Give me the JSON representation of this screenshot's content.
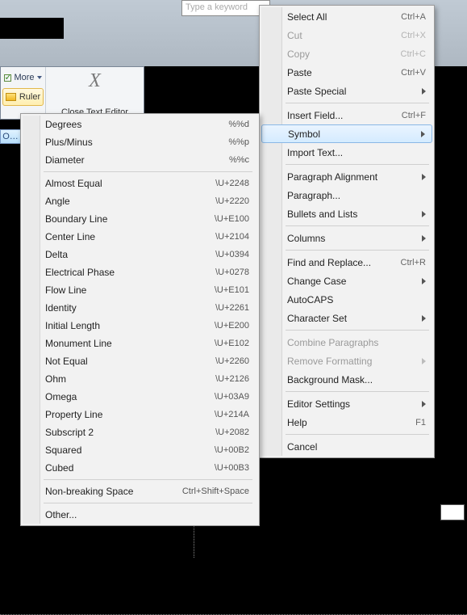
{
  "ribbon": {
    "keyword_placeholder": "Type a keyword",
    "more_label": "More",
    "ruler_label": "Ruler",
    "close_label": "Close Text Editor",
    "close_icon": "X",
    "options_tab": "O…"
  },
  "context_menu": {
    "groups": [
      [
        {
          "label": "Select All",
          "accel": "Ctrl+A",
          "enabled": true
        },
        {
          "label": "Cut",
          "accel": "Ctrl+X",
          "enabled": false
        },
        {
          "label": "Copy",
          "accel": "Ctrl+C",
          "enabled": false
        },
        {
          "label": "Paste",
          "accel": "Ctrl+V",
          "enabled": true
        },
        {
          "label": "Paste Special",
          "submenu": true,
          "enabled": true
        }
      ],
      [
        {
          "label": "Insert Field...",
          "accel": "Ctrl+F",
          "enabled": true
        },
        {
          "label": "Symbol",
          "submenu": true,
          "enabled": true,
          "highlight": true
        },
        {
          "label": "Import Text...",
          "enabled": true
        }
      ],
      [
        {
          "label": "Paragraph Alignment",
          "submenu": true,
          "enabled": true
        },
        {
          "label": "Paragraph...",
          "enabled": true
        },
        {
          "label": "Bullets and Lists",
          "submenu": true,
          "enabled": true
        }
      ],
      [
        {
          "label": "Columns",
          "submenu": true,
          "enabled": true
        }
      ],
      [
        {
          "label": "Find and Replace...",
          "accel": "Ctrl+R",
          "enabled": true
        },
        {
          "label": "Change Case",
          "submenu": true,
          "enabled": true
        },
        {
          "label": "AutoCAPS",
          "enabled": true
        },
        {
          "label": "Character Set",
          "submenu": true,
          "enabled": true
        }
      ],
      [
        {
          "label": "Combine Paragraphs",
          "enabled": false
        },
        {
          "label": "Remove Formatting",
          "submenu": true,
          "enabled": false
        },
        {
          "label": "Background Mask...",
          "enabled": true
        }
      ],
      [
        {
          "label": "Editor Settings",
          "submenu": true,
          "enabled": true
        },
        {
          "label": "Help",
          "accel": "F1",
          "enabled": true
        }
      ],
      [
        {
          "label": "Cancel",
          "enabled": true
        }
      ]
    ]
  },
  "symbol_menu": {
    "groups": [
      [
        {
          "label": "Degrees",
          "code": "%%d"
        },
        {
          "label": "Plus/Minus",
          "code": "%%p"
        },
        {
          "label": "Diameter",
          "code": "%%c"
        }
      ],
      [
        {
          "label": "Almost Equal",
          "code": "\\U+2248"
        },
        {
          "label": "Angle",
          "code": "\\U+2220"
        },
        {
          "label": "Boundary Line",
          "code": "\\U+E100"
        },
        {
          "label": "Center Line",
          "code": "\\U+2104"
        },
        {
          "label": "Delta",
          "code": "\\U+0394"
        },
        {
          "label": "Electrical Phase",
          "code": "\\U+0278"
        },
        {
          "label": "Flow Line",
          "code": "\\U+E101"
        },
        {
          "label": "Identity",
          "code": "\\U+2261"
        },
        {
          "label": "Initial Length",
          "code": "\\U+E200"
        },
        {
          "label": "Monument Line",
          "code": "\\U+E102"
        },
        {
          "label": "Not Equal",
          "code": "\\U+2260"
        },
        {
          "label": "Ohm",
          "code": "\\U+2126"
        },
        {
          "label": "Omega",
          "code": "\\U+03A9"
        },
        {
          "label": "Property Line",
          "code": "\\U+214A"
        },
        {
          "label": "Subscript 2",
          "code": "\\U+2082"
        },
        {
          "label": "Squared",
          "code": "\\U+00B2"
        },
        {
          "label": "Cubed",
          "code": "\\U+00B3"
        }
      ],
      [
        {
          "label": "Non-breaking Space",
          "code": "Ctrl+Shift+Space"
        }
      ],
      [
        {
          "label": "Other...",
          "code": ""
        }
      ]
    ]
  }
}
